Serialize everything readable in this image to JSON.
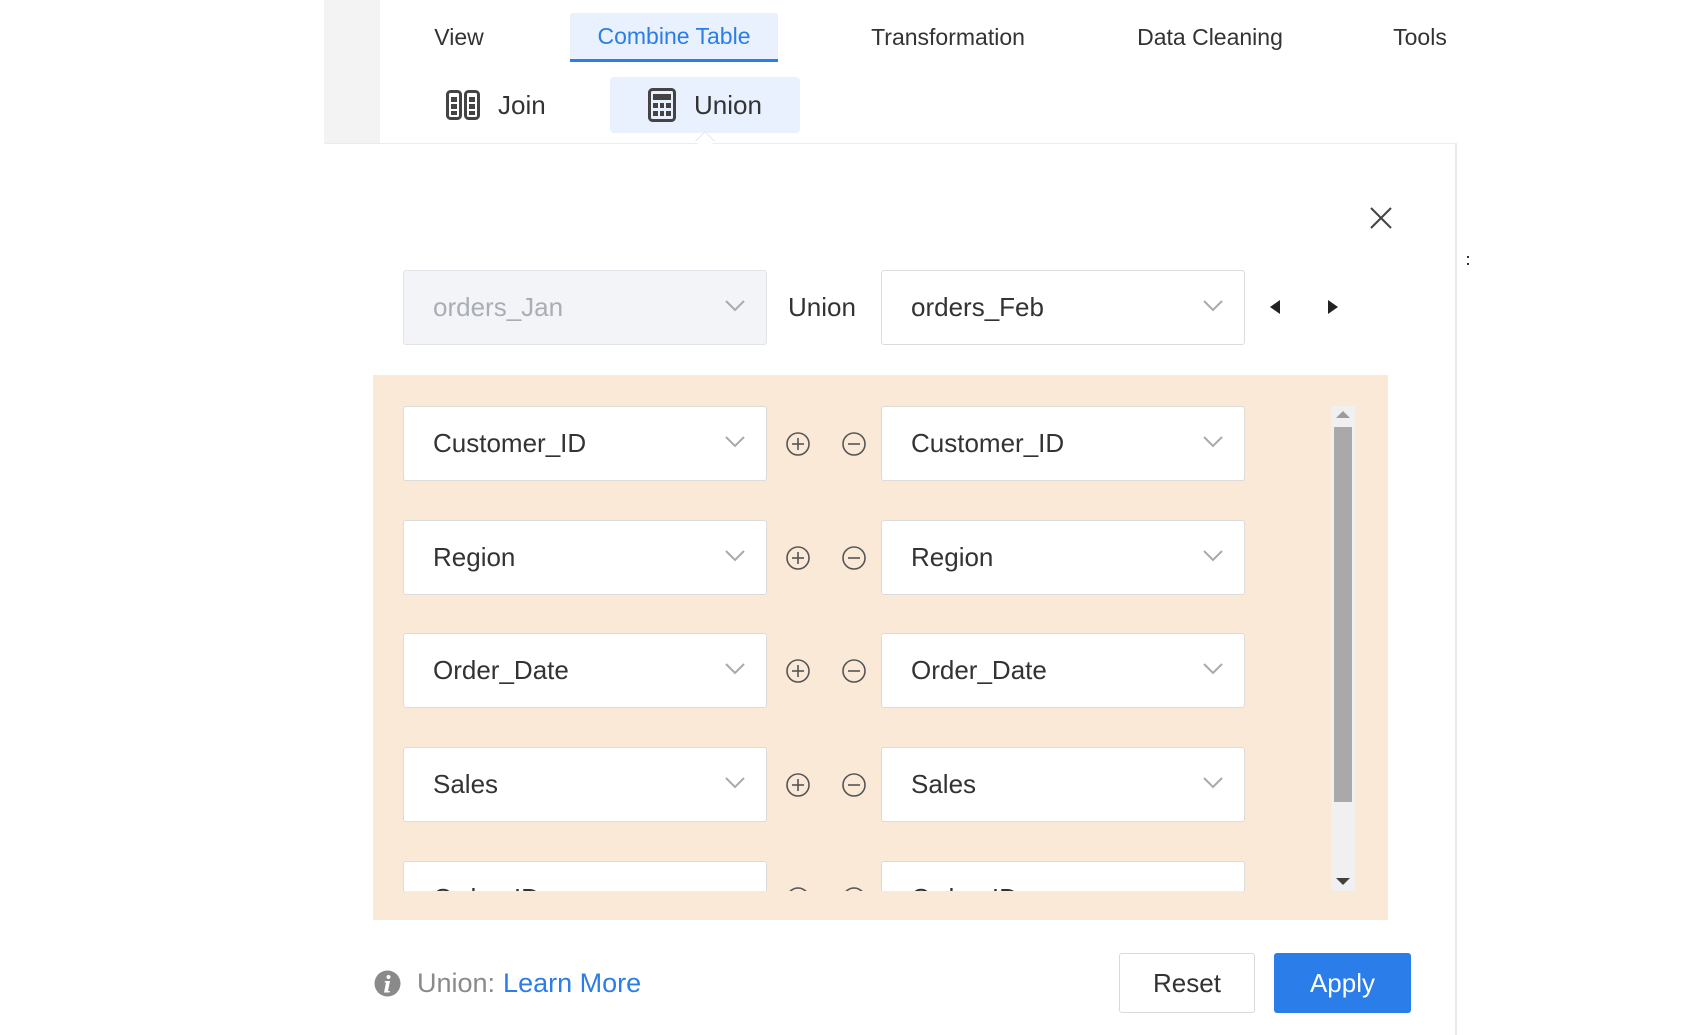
{
  "tabs": [
    {
      "label": "View",
      "active": false
    },
    {
      "label": "Combine Table",
      "active": true
    },
    {
      "label": "Transformation",
      "active": false
    },
    {
      "label": "Data Cleaning",
      "active": false
    },
    {
      "label": "Tools",
      "active": false
    }
  ],
  "subtools": [
    {
      "label": "Join",
      "icon": "join-table-icon",
      "active": false
    },
    {
      "label": "Union",
      "icon": "union-table-icon",
      "active": true
    }
  ],
  "dialog": {
    "left_table": "orders_Jan",
    "operator": "Union",
    "right_table": "orders_Feb",
    "rows": [
      {
        "left": "Customer_ID",
        "right": "Customer_ID"
      },
      {
        "left": "Region",
        "right": "Region"
      },
      {
        "left": "Order_Date",
        "right": "Order_Date"
      },
      {
        "left": "Sales",
        "right": "Sales"
      },
      {
        "left": "Order_ID",
        "right": "Order_ID"
      }
    ],
    "footer": {
      "prefix": "Union:",
      "link": "Learn More"
    },
    "buttons": {
      "reset": "Reset",
      "apply": "Apply"
    }
  },
  "colors": {
    "accent": "#2b7de9",
    "mapping_bg": "#fbe9d8",
    "active_tab_bg": "#e8f1fd"
  }
}
